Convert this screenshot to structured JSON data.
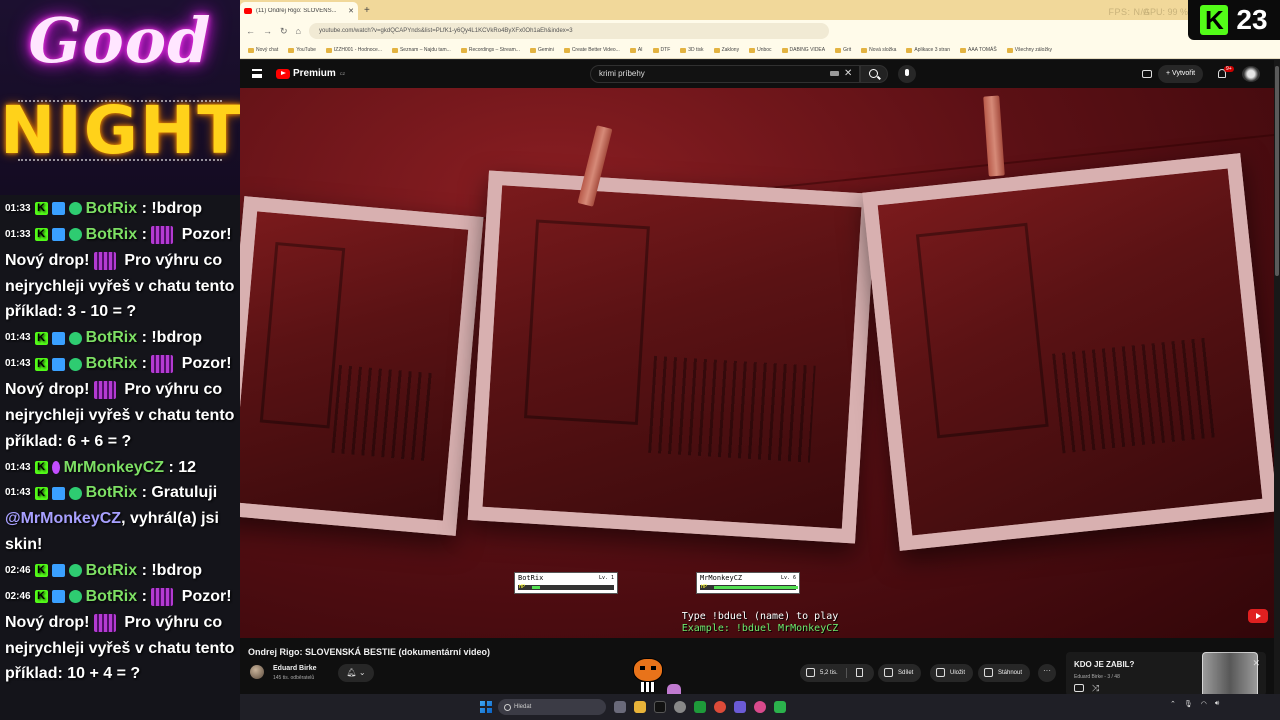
{
  "overlay": {
    "good": "Good",
    "night": "NIGHT"
  },
  "chat": [
    {
      "time": "01:33",
      "user": "BotRix",
      "text": ": !bdrop",
      "emote": false
    },
    {
      "time": "01:33",
      "user": "BotRix",
      "text": ": ",
      "emote": true,
      "after": "Pozor! Nový drop! ",
      "after2": " Pro výhru co nejrychleji vyřeš v chatu tento příklad: 3 - 10 = ?"
    },
    {
      "time": "01:43",
      "user": "BotRix",
      "text": ": !bdrop",
      "emote": false
    },
    {
      "time": "01:43",
      "user": "BotRix",
      "text": ": ",
      "emote": true,
      "after": "Pozor! Nový drop! ",
      "after2": " Pro výhru co nejrychleji vyřeš v chatu tento příklad: 6 + 6 = ?"
    },
    {
      "time": "01:43",
      "user": "MrMonkeyCZ",
      "text": ": 12",
      "emote": false
    },
    {
      "time": "01:43",
      "user": "BotRix",
      "text": ": Gratuluji ",
      "mention": "@MrMonkeyCZ",
      "tail": ", vyhrál(a) jsi skin!"
    },
    {
      "time": "02:46",
      "user": "BotRix",
      "text": ": !bdrop",
      "emote": false
    },
    {
      "time": "02:46",
      "user": "BotRix",
      "text": ": ",
      "emote": true,
      "after": "Pozor! Nový drop! ",
      "after2": " Pro výhru co nejrychleji vyřeš v chatu tento příklad: 10 + 4 = ?"
    }
  ],
  "browser": {
    "tab_title": "(11) Ondrej Rigo: SLOVENS...",
    "fps": "FPS: N/A",
    "gpu": "GPU: 99 %",
    "url": "youtube.com/watch?v=gkdQCAPYnds&list=PLfK1-y6Qy4L1KCVkRo4ByXFx0Oh1aEh&index=3",
    "bookmarks": [
      "Nový chat",
      "YouTube",
      "IZZH001 - Hodnoce...",
      "Seznam – Najdu tam...",
      "Recordings – Stream...",
      "Gemini",
      "Create Better Video...",
      "AI",
      "DTF",
      "3D tisk",
      "Zaklony",
      "Unboc",
      "DABING VIDEA",
      "Grit",
      "Nová složka",
      "Aplikace 3 stran",
      "AAA TOMÁŠ",
      "Všechny záložky"
    ]
  },
  "kick": {
    "logo": "K",
    "count": "23"
  },
  "youtube": {
    "logo_word": "Premium",
    "logo_cc": "CZ",
    "search_value": "krimi príbehy",
    "create_label": "Vytvořit",
    "notif_count": "9+"
  },
  "duel": {
    "p1_name": "BotRix",
    "p1_level": "Lv. 1",
    "p2_name": "MrMonkeyCZ",
    "p2_level": "Lv. 6",
    "hp_label": "HP",
    "p1_hp": 0.1,
    "p2_hp": 1.0,
    "instruction": "Type !bduel (name) to play",
    "example": "Example: !bduel MrMonkeyCZ"
  },
  "video": {
    "title": "Ondrej Rigo: SLOVENSKÁ BESTIE (dokumentární video)",
    "channel": "Eduard Birke",
    "subscribers": "145 tis. odběratelů",
    "likes": "5,2 tis.",
    "share": "Sdílet",
    "save": "Uložit",
    "download": "Stáhnout",
    "more": "···"
  },
  "up_next": {
    "title": "KDO JE ZABIL?",
    "meta": "Eduard Birke - 3 / 48"
  },
  "taskbar": {
    "search_placeholder": "Hledat"
  }
}
